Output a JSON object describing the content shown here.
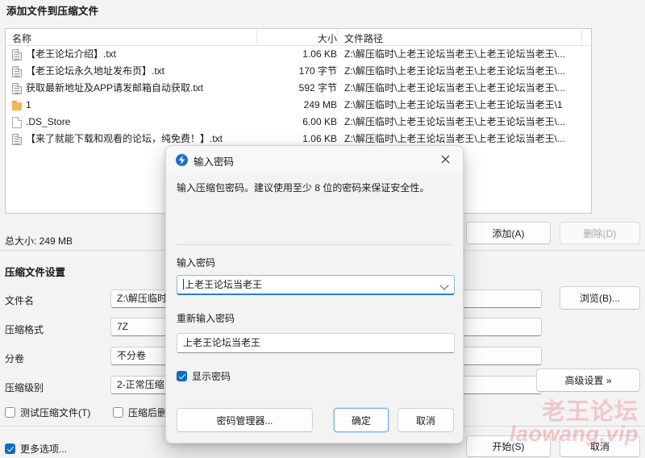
{
  "window": {
    "title": "添加文件到压缩文件"
  },
  "file_list": {
    "columns": [
      "名称",
      "大小",
      "文件路径"
    ],
    "rows": [
      {
        "icon": "text-file-icon",
        "name": "【老王论坛介绍】.txt",
        "size": "1.06 KB",
        "path": "Z:\\解压临时\\上老王论坛当老王\\上老王论坛当老王\\..."
      },
      {
        "icon": "text-file-icon",
        "name": "【老王论坛永久地址发布页】.txt",
        "size": "170 字节",
        "path": "Z:\\解压临时\\上老王论坛当老王\\上老王论坛当老王\\..."
      },
      {
        "icon": "text-file-icon",
        "name": "获取最新地址及APP请发邮箱自动获取.txt",
        "size": "592 字节",
        "path": "Z:\\解压临时\\上老王论坛当老王\\上老王论坛当老王\\..."
      },
      {
        "icon": "folder-icon",
        "name": "1",
        "size": "249 MB",
        "path": "Z:\\解压临时\\上老王论坛当老王\\上老王论坛当老王\\1"
      },
      {
        "icon": "blank-file-icon",
        "name": ".DS_Store",
        "size": "6.00 KB",
        "path": "Z:\\解压临时\\上老王论坛当老王\\上老王论坛当老王\\..."
      },
      {
        "icon": "text-file-icon",
        "name": "【来了就能下载和观看的论坛，纯免费！】.txt",
        "size": "1.06 KB",
        "path": "Z:\\解压临时\\上老王论坛当老王\\上老王论坛当老王\\..."
      }
    ]
  },
  "summary": {
    "total_size": "总大小: 249 MB"
  },
  "toolbar": {
    "add_label": "添加(A)",
    "delete_label": "删除(D)"
  },
  "settings": {
    "section_title": "压缩文件设置",
    "filename_label": "文件名",
    "filename_value": "Z:\\解压临时",
    "browse_label": "浏览(B)...",
    "format_label": "压缩格式",
    "format_value": "7Z",
    "volume_label": "分卷",
    "volume_value": "不分卷",
    "level_label": "压缩级别",
    "level_value": "2-正常压缩",
    "advanced_label": "高级设置 »",
    "test_checkbox": "测试压缩文件(T)",
    "test_checked": false,
    "delete_after_checkbox": "压缩后删",
    "delete_after_checked": false,
    "more_options": "更多选项...",
    "more_options_checked": true
  },
  "footer": {
    "start_label": "开始(S)",
    "cancel_label": "取消"
  },
  "dialog": {
    "icon": "app-badge-icon",
    "title": "输入密码",
    "close_icon": "close-icon",
    "description": "输入压缩包密码。建议使用至少 8 位的密码来保证安全性。",
    "password_label": "输入密码",
    "password_value": "上老王论坛当老王",
    "password_dropdown_icon": "chevron-down-icon",
    "confirm_label": "重新输入密码",
    "confirm_value": "上老王论坛当老王",
    "show_password_label": "显示密码",
    "show_password_checked": true,
    "manager_label": "密码管理器...",
    "ok_label": "确定",
    "cancel_label": "取消"
  },
  "watermark": {
    "line1": "老王论坛",
    "line2": "laowang.vip"
  },
  "colors": {
    "accent": "#0f6cbd",
    "dialog_icon": "#1f6fc4",
    "folder": "#f2b955",
    "watermark": "#e96e7d"
  }
}
